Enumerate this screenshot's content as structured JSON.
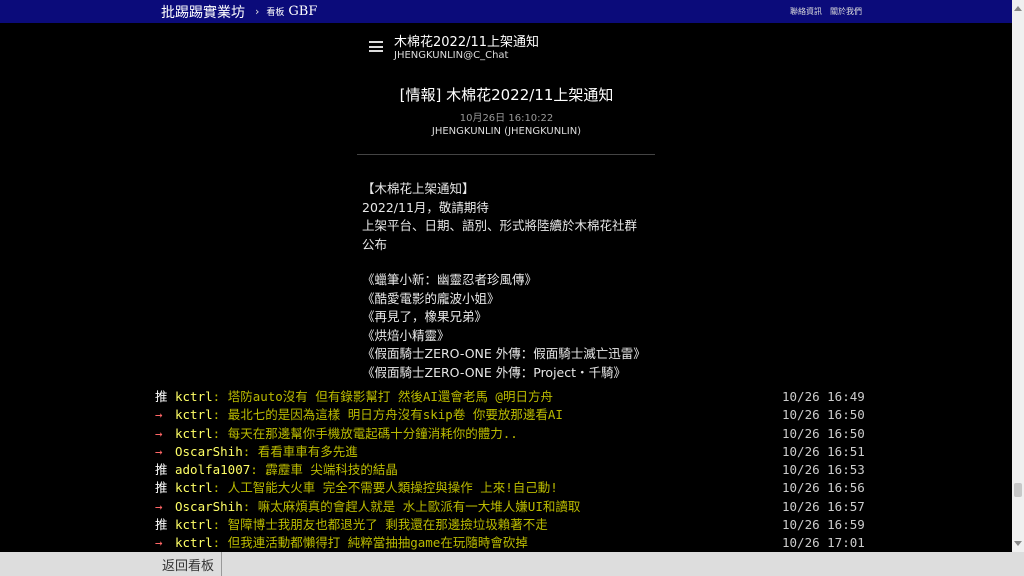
{
  "topbar": {
    "brand": "批踢踢實業坊",
    "separator": "›",
    "board_label": "看板",
    "board_name": "GBF",
    "links": [
      "聯絡資訊",
      "關於我們"
    ]
  },
  "header": {
    "title": "木棉花2022/11上架通知",
    "subtitle": "JHENGKUNLIN@C_Chat",
    "menu_icon": "hamburger-menu-icon"
  },
  "post": {
    "title": "[情報] 木棉花2022/11上架通知",
    "time": "10月26日 16:10:22",
    "author": "JHENGKUNLIN (JHENGKUNLIN)"
  },
  "content": {
    "paragraph1": [
      "【木棉花上架通知】",
      "2022/11月，敬請期待",
      "上架平台、日期、語別、形式將陸續於木棉花社群",
      "公布"
    ],
    "paragraph2": [
      "《蠟筆小新：幽靈忍者珍風傳》",
      "《酷愛電影的龐波小姐》",
      "《再見了，橡果兄弟》",
      "《烘焙小精靈》",
      "《假面騎士ZERO-ONE 外傳：假面騎士滅亡迅雷》",
      "《假面騎士ZERO-ONE 外傳：Project・千騎》"
    ]
  },
  "comments": [
    {
      "tag": "推",
      "type": "good",
      "user": "kctrl",
      "text": ": 塔防auto沒有 但有錄影幫打 然後AI還會老馬 @明日方舟",
      "time": "10/26 16:49"
    },
    {
      "tag": "→",
      "type": "arrow",
      "user": "kctrl",
      "text": ": 最北七的是因為這樣 明日方舟沒有skip卷 你要放那邊看AI",
      "time": "10/26 16:50"
    },
    {
      "tag": "→",
      "type": "arrow",
      "user": "kctrl",
      "text": ": 每天在那邊幫你手機放電起碼十分鐘消耗你的體力..",
      "time": "10/26 16:50"
    },
    {
      "tag": "→",
      "type": "arrow",
      "user": "OscarShih",
      "text": ": 看看車車有多先進",
      "time": "10/26 16:51"
    },
    {
      "tag": "推",
      "type": "good",
      "user": "adolfa1007",
      "text": ": 霹靂車 尖端科技的結晶",
      "time": "10/26 16:53"
    },
    {
      "tag": "推",
      "type": "good",
      "user": "kctrl",
      "text": ": 人工智能大火車 完全不需要人類操控與操作 上來!自己動!",
      "time": "10/26 16:56"
    },
    {
      "tag": "→",
      "type": "arrow",
      "user": "OscarShih",
      "text": ": 嘛太麻煩真的會趕人就是 水上歐派有一大堆人嫌UI和讀取",
      "time": "10/26 16:57"
    },
    {
      "tag": "推",
      "type": "good",
      "user": "kctrl",
      "text": ": 智障博士我朋友也都退光了 剩我還在那邊撿垃圾賴著不走",
      "time": "10/26 16:59"
    },
    {
      "tag": "→",
      "type": "arrow",
      "user": "kctrl",
      "text": ": 但我連活動都懶得打 純粹當抽抽game在玩隨時會砍掉",
      "time": "10/26 17:01"
    }
  ],
  "footer": {
    "back_label": "返回看板"
  }
}
